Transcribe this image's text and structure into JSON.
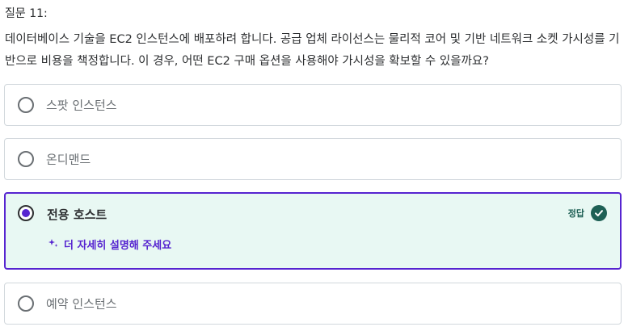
{
  "question": {
    "number_label": "질문 11:",
    "text": "데이터베이스 기술을 EC2 인스턴스에 배포하려 합니다. 공급 업체 라이선스는 물리적 코어 및 기반 네트워크 소켓 가시성를 기반으로 비용을 책정합니다. 이 경우, 어떤 EC2 구매 옵션을 사용해야 가시성을 확보할 수 있을까요?"
  },
  "options": [
    {
      "label": "스팟 인스턴스",
      "selected": false,
      "correct": false
    },
    {
      "label": "온디맨드",
      "selected": false,
      "correct": false
    },
    {
      "label": "전용 호스트",
      "selected": true,
      "correct": true
    },
    {
      "label": "예약 인스턴스",
      "selected": false,
      "correct": false
    }
  ],
  "feedback": {
    "correct_badge": "정답",
    "explain_link": "더 자세히 설명해 주세요",
    "explain_icon": "sparkle-icon",
    "check_icon": "check-circle-icon"
  },
  "colors": {
    "accent": "#5624d0",
    "correct_bg": "#e8f8f3",
    "correct_badge": "#1e6055",
    "border": "#d1d7dc"
  }
}
